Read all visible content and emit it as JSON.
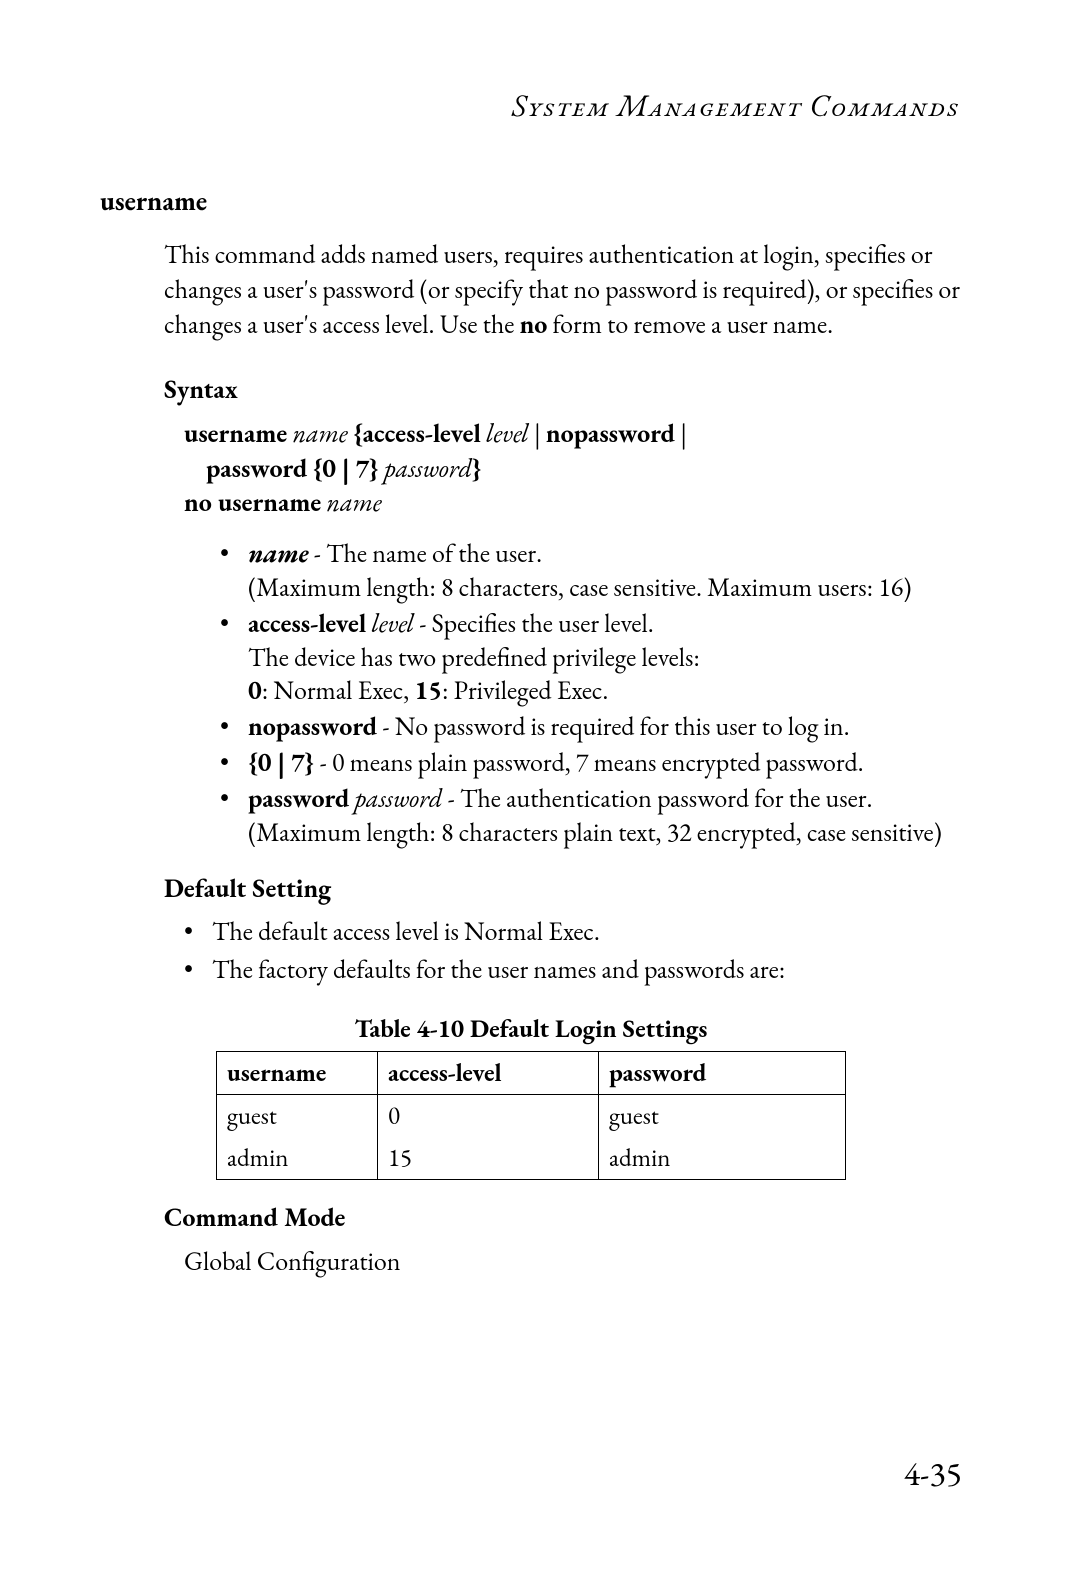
{
  "header": {
    "running_head": "System Management Commands"
  },
  "section": {
    "title": "username",
    "intro_pre": "This command adds named users, requires authentication at login, specifies or changes a user's password (or specify that no password is required), or specifies or changes a user's access level. Use the ",
    "intro_bold": "no",
    "intro_post": " form to remove a user name."
  },
  "syntax": {
    "heading": "Syntax",
    "cmd1_kw1": "username",
    "cmd1_arg1": "name",
    "cmd1_open_brace": "{",
    "cmd1_kw2": "access-level",
    "cmd1_arg2": "level",
    "cmd1_pipe1": " | ",
    "cmd1_kw3": "nopassword",
    "cmd1_pipe2": " | ",
    "cmd2_kw1": "password",
    "cmd2_grp": "{0 | 7}",
    "cmd2_arg1": "password",
    "cmd2_close_brace": "}",
    "cmd3_kw1": "no username",
    "cmd3_arg1": "name"
  },
  "params": {
    "p1_kw": "name",
    "p1_sep": " - ",
    "p1_desc": "The name of the user.",
    "p1_line2": "(Maximum length: 8 characters, case sensitive. Maximum users: 16)",
    "p2_kw": "access-level",
    "p2_arg": "level",
    "p2_sep": " - ",
    "p2_desc": "Specifies the user level.",
    "p2_line2": "The device has two predefined privilege levels:",
    "p2_line3_a": "0",
    "p2_line3_b": ": Normal Exec, ",
    "p2_line3_c": "15",
    "p2_line3_d": ": Privileged Exec.",
    "p3_kw": "nopassword",
    "p3_sep": " - ",
    "p3_desc": "No password is required for this user to log in.",
    "p4_kw": "{0 | 7}",
    "p4_sep": " - ",
    "p4_desc": "0 means plain password, 7 means encrypted password.",
    "p5_kw": "password",
    "p5_arg": "password",
    "p5_sep": " - ",
    "p5_desc": "The authentication password for the user.",
    "p5_line2": "(Maximum length: 8 characters plain text, 32 encrypted, case sensitive)"
  },
  "default_setting": {
    "heading": "Default Setting",
    "item1": "The default access level is Normal Exec.",
    "item2": "The factory defaults for the user names and passwords are:"
  },
  "table": {
    "caption": "Table 4-10  Default Login Settings",
    "headers": {
      "h1": "username",
      "h2": "access-level",
      "h3": "password"
    },
    "rows": [
      {
        "c1": "guest",
        "c2": "0",
        "c3": "guest"
      },
      {
        "c1": "admin",
        "c2": "15",
        "c3": "admin"
      }
    ]
  },
  "command_mode": {
    "heading": "Command Mode",
    "value": "Global Configuration"
  },
  "page_number": "4-35"
}
